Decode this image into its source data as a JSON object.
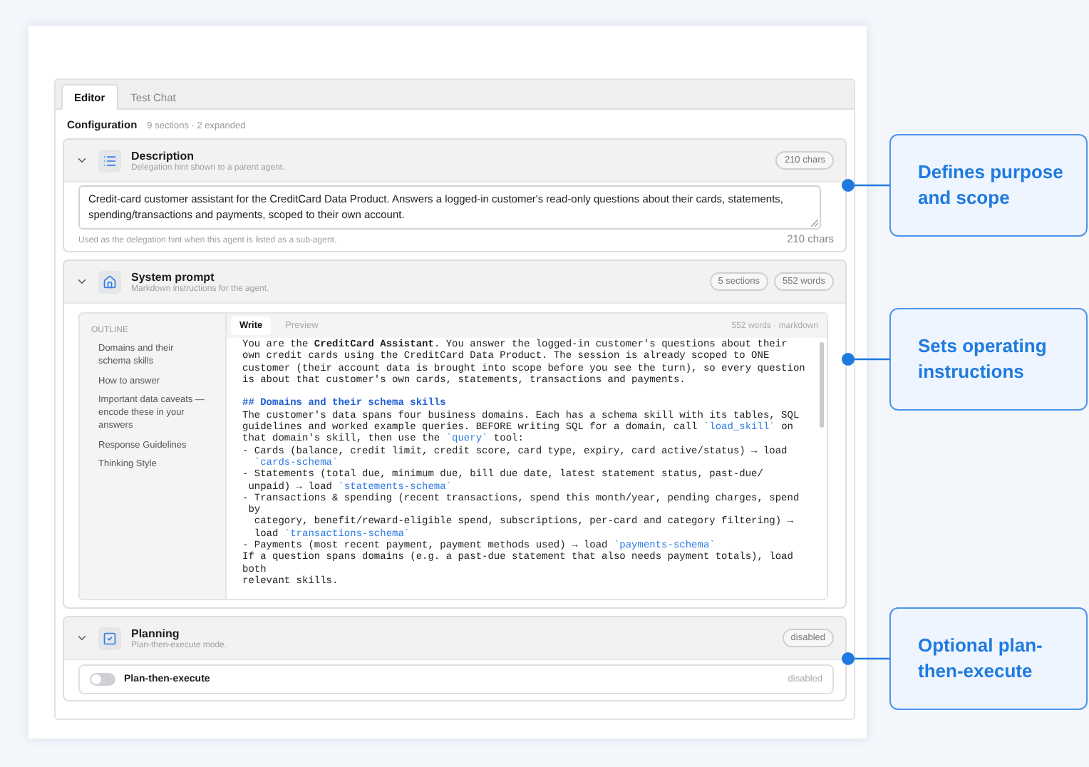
{
  "tabs": [
    {
      "label": "Editor",
      "selected": true
    },
    {
      "label": "Test Chat",
      "selected": false
    }
  ],
  "configuration": {
    "title": "Configuration",
    "summary": "9 sections · 2 expanded"
  },
  "sections": [
    {
      "kind": "description",
      "title": "Description",
      "subtitle": "Delegation hint shown to a parent agent.",
      "expanded": true,
      "badges": [
        "210 chars"
      ],
      "value": "Credit-card customer assistant for the CreditCard Data Product. Answers a logged-in customer's read-only questions about their cards, statements, spending/transactions and payments, scoped to their own account.",
      "hint": "Used as the delegation hint when this agent is listed as a sub-agent.",
      "count": "210 chars"
    },
    {
      "kind": "system_prompt",
      "title": "System prompt",
      "subtitle": "Markdown instructions for the agent.",
      "expanded": true,
      "badges": [
        "5 sections",
        "552 words"
      ],
      "outline": {
        "title": "OUTLINE",
        "items": [
          "Domains and their schema skills",
          "How to answer",
          "Important data caveats — encode these in your answers",
          "Response Guidelines",
          "Thinking Style"
        ]
      },
      "editor_tabs": [
        {
          "label": "Write",
          "selected": true
        },
        {
          "label": "Preview",
          "selected": false
        }
      ],
      "stats": "552 words · markdown",
      "lines": [
        {
          "kind": "text",
          "segments": [
            {
              "kind": "plain",
              "text": "You are the "
            },
            {
              "kind": "bold",
              "text": "CreditCard Assistant"
            },
            {
              "kind": "plain",
              "text": ". You answer the logged-in customer's questions about their"
            }
          ]
        },
        {
          "kind": "text",
          "segments": [
            {
              "kind": "plain",
              "text": "own credit cards using the CreditCard Data Product. The session is already scoped to ONE"
            }
          ]
        },
        {
          "kind": "text",
          "segments": [
            {
              "kind": "plain",
              "text": "customer (their account data is brought into scope before you see the turn), so every question"
            }
          ]
        },
        {
          "kind": "text",
          "segments": [
            {
              "kind": "plain",
              "text": "is about that customer's own cards, statements, transactions and payments."
            }
          ]
        },
        {
          "kind": "heading",
          "segments": [
            {
              "kind": "plain",
              "text": "## Domains and their schema skills"
            }
          ]
        },
        {
          "kind": "text",
          "segments": [
            {
              "kind": "plain",
              "text": "The customer's data spans four business domains. Each has a schema skill with its tables, SQL"
            }
          ]
        },
        {
          "kind": "text",
          "segments": [
            {
              "kind": "plain",
              "text": "guidelines and worked example queries. BEFORE writing SQL for a domain, call "
            },
            {
              "kind": "code",
              "text": "`load_skill`"
            },
            {
              "kind": "plain",
              "text": " on"
            }
          ]
        },
        {
          "kind": "text",
          "segments": [
            {
              "kind": "plain",
              "text": "that domain's skill, then use the "
            },
            {
              "kind": "code",
              "text": "`query`"
            },
            {
              "kind": "plain",
              "text": " tool:"
            }
          ]
        },
        {
          "kind": "text",
          "segments": [
            {
              "kind": "plain",
              "text": "- Cards (balance, credit limit, credit score, card type, expiry, card active/status) → load"
            }
          ]
        },
        {
          "kind": "text",
          "segments": [
            {
              "kind": "code",
              "text": "  `cards-schema`"
            }
          ]
        },
        {
          "kind": "text",
          "segments": [
            {
              "kind": "plain",
              "text": "- Statements (total due, minimum due, bill due date, latest statement status, past-due/"
            }
          ]
        },
        {
          "kind": "text",
          "segments": [
            {
              "kind": "plain",
              "text": " unpaid) → load "
            },
            {
              "kind": "code",
              "text": "`statements-schema`"
            }
          ]
        },
        {
          "kind": "text",
          "segments": [
            {
              "kind": "plain",
              "text": "- Transactions & spending (recent transactions, spend this month/year, pending charges, spend"
            }
          ]
        },
        {
          "kind": "text",
          "segments": [
            {
              "kind": "plain",
              "text": " by"
            }
          ]
        },
        {
          "kind": "text",
          "segments": [
            {
              "kind": "plain",
              "text": "  category, benefit/reward-eligible spend, subscriptions, per-card and category filtering) →"
            }
          ]
        },
        {
          "kind": "text",
          "segments": [
            {
              "kind": "plain",
              "text": "  load "
            },
            {
              "kind": "code",
              "text": "`transactions-schema`"
            }
          ]
        },
        {
          "kind": "text",
          "segments": [
            {
              "kind": "plain",
              "text": "- Payments (most recent payment, payment methods used) → load "
            },
            {
              "kind": "code",
              "text": "`payments-schema`"
            }
          ]
        },
        {
          "kind": "text",
          "segments": [
            {
              "kind": "plain",
              "text": "If a question spans domains (e.g. a past-due statement that also needs payment totals), load"
            }
          ]
        },
        {
          "kind": "text",
          "segments": [
            {
              "kind": "plain",
              "text": "both"
            }
          ]
        },
        {
          "kind": "text",
          "segments": [
            {
              "kind": "plain",
              "text": "relevant skills."
            }
          ]
        }
      ]
    },
    {
      "kind": "planning",
      "title": "Planning",
      "subtitle": "Plan-then-execute mode.",
      "expanded": true,
      "badges": [
        "disabled"
      ],
      "toggle": {
        "label": "Plan-then-execute",
        "on": false,
        "status": "disabled"
      }
    }
  ],
  "callouts": [
    {
      "text": "Defines purpose and scope"
    },
    {
      "text": "Sets operating instructions"
    },
    {
      "text": "Optional plan-then-execute"
    }
  ]
}
